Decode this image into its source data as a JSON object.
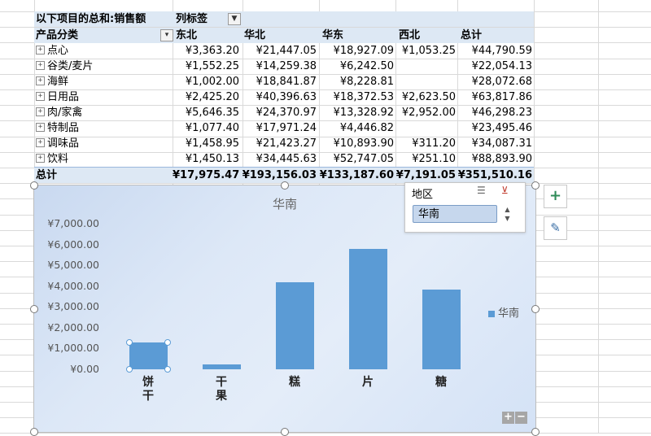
{
  "pivot": {
    "values_header": "以下项目的总和:销售额",
    "columns_header": "列标签",
    "row_header": "产品分类",
    "columns": [
      "东北",
      "华北",
      "华东",
      "西北",
      "总计"
    ],
    "rows": [
      {
        "label": "点心",
        "values": [
          "¥3,363.20",
          "¥21,447.05",
          "¥18,927.09",
          "¥1,053.25",
          "¥44,790.59"
        ]
      },
      {
        "label": "谷类/麦片",
        "values": [
          "¥1,552.25",
          "¥14,259.38",
          "¥6,242.50",
          "",
          "¥22,054.13"
        ]
      },
      {
        "label": "海鲜",
        "values": [
          "¥1,002.00",
          "¥18,841.87",
          "¥8,228.81",
          "",
          "¥28,072.68"
        ]
      },
      {
        "label": "日用品",
        "values": [
          "¥2,425.20",
          "¥40,396.63",
          "¥18,372.53",
          "¥2,623.50",
          "¥63,817.86"
        ]
      },
      {
        "label": "肉/家禽",
        "values": [
          "¥5,646.35",
          "¥24,370.97",
          "¥13,328.92",
          "¥2,952.00",
          "¥46,298.23"
        ]
      },
      {
        "label": "特制品",
        "values": [
          "¥1,077.40",
          "¥17,971.24",
          "¥4,446.82",
          "",
          "¥23,495.46"
        ]
      },
      {
        "label": "调味品",
        "values": [
          "¥1,458.95",
          "¥21,423.27",
          "¥10,893.90",
          "¥311.20",
          "¥34,087.31"
        ]
      },
      {
        "label": "饮料",
        "values": [
          "¥1,450.13",
          "¥34,445.63",
          "¥52,747.05",
          "¥251.10",
          "¥88,893.90"
        ]
      }
    ],
    "total": {
      "label": "总计",
      "values": [
        "¥17,975.47",
        "¥193,156.03",
        "¥133,187.60",
        "¥7,191.05",
        "¥351,510.16"
      ]
    }
  },
  "slicer": {
    "title": "地区",
    "selected_item": "华南",
    "icons": [
      "multi-select-icon",
      "clear-filter-icon"
    ]
  },
  "chart_data": {
    "type": "bar",
    "title": "华南",
    "categories": [
      "饼干",
      "干果",
      "糕",
      "片",
      "糖"
    ],
    "category_labels": [
      [
        "饼",
        "干"
      ],
      [
        "干",
        "果"
      ],
      [
        "糕"
      ],
      [
        "片"
      ],
      [
        "糖"
      ]
    ],
    "series": [
      {
        "name": "华南",
        "color": "#5b9bd5",
        "values": [
          1300,
          250,
          4200,
          5800,
          3850
        ]
      }
    ],
    "yticks": [
      "¥7,000.00",
      "¥6,000.00",
      "¥5,000.00",
      "¥4,000.00",
      "¥3,000.00",
      "¥2,000.00",
      "¥1,000.00",
      "¥0.00"
    ],
    "ylim": [
      0,
      7000
    ],
    "legend": "right",
    "selected_point_index": 0
  },
  "side_tools": [
    "chart-elements-plus-icon",
    "chart-styles-brush-icon"
  ],
  "zoom": {
    "plus": "+",
    "minus": "−"
  }
}
